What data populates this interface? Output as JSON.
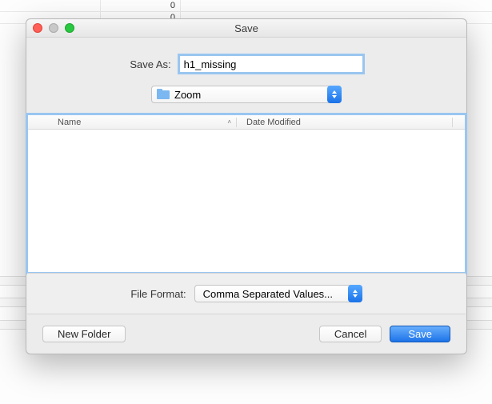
{
  "background": {
    "cells": [
      "0",
      "0"
    ]
  },
  "dialog": {
    "title": "Save",
    "save_as_label": "Save As:",
    "filename": "h1_missing",
    "folder_name": "Zoom",
    "columns": {
      "name": "Name",
      "date": "Date Modified"
    },
    "format_label": "File Format:",
    "format_value": "Comma Separated Values...",
    "buttons": {
      "new_folder": "New Folder",
      "cancel": "Cancel",
      "save": "Save"
    }
  }
}
